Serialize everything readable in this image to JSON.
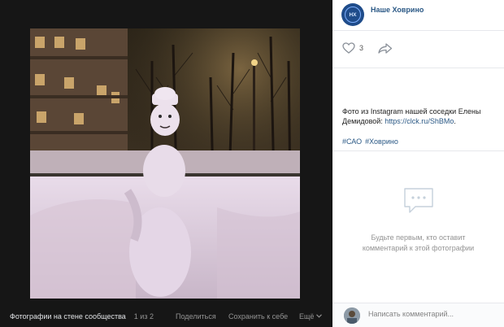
{
  "viewer": {
    "album_title": "Фотографии на стене сообщества",
    "counter": "1 из 2",
    "actions": {
      "share": "Поделиться",
      "save": "Сохранить к себе",
      "more": "Ещё"
    }
  },
  "group": {
    "name": "Наше Ховрино",
    "avatar_initials": "НХ"
  },
  "likes": {
    "count": "3"
  },
  "post": {
    "text_prefix": "Фото из Instagram нашей соседки Елены Демидовой: ",
    "link": "https://clck.ru/ShBMo",
    "text_suffix": ".",
    "tags": [
      "#САО",
      "#Ховрино"
    ]
  },
  "comments": {
    "empty_text": "Будьте первым, кто оставит комментарий к этой фотографии",
    "input_placeholder": "Написать комментарий..."
  },
  "icons": {
    "like": "heart-icon",
    "share": "share-arrow-icon",
    "empty": "comment-bubbles-icon",
    "more": "chevron-down-icon"
  },
  "colors": {
    "viewer_bg": "#161616",
    "link": "#2a5885",
    "muted": "#939393"
  }
}
